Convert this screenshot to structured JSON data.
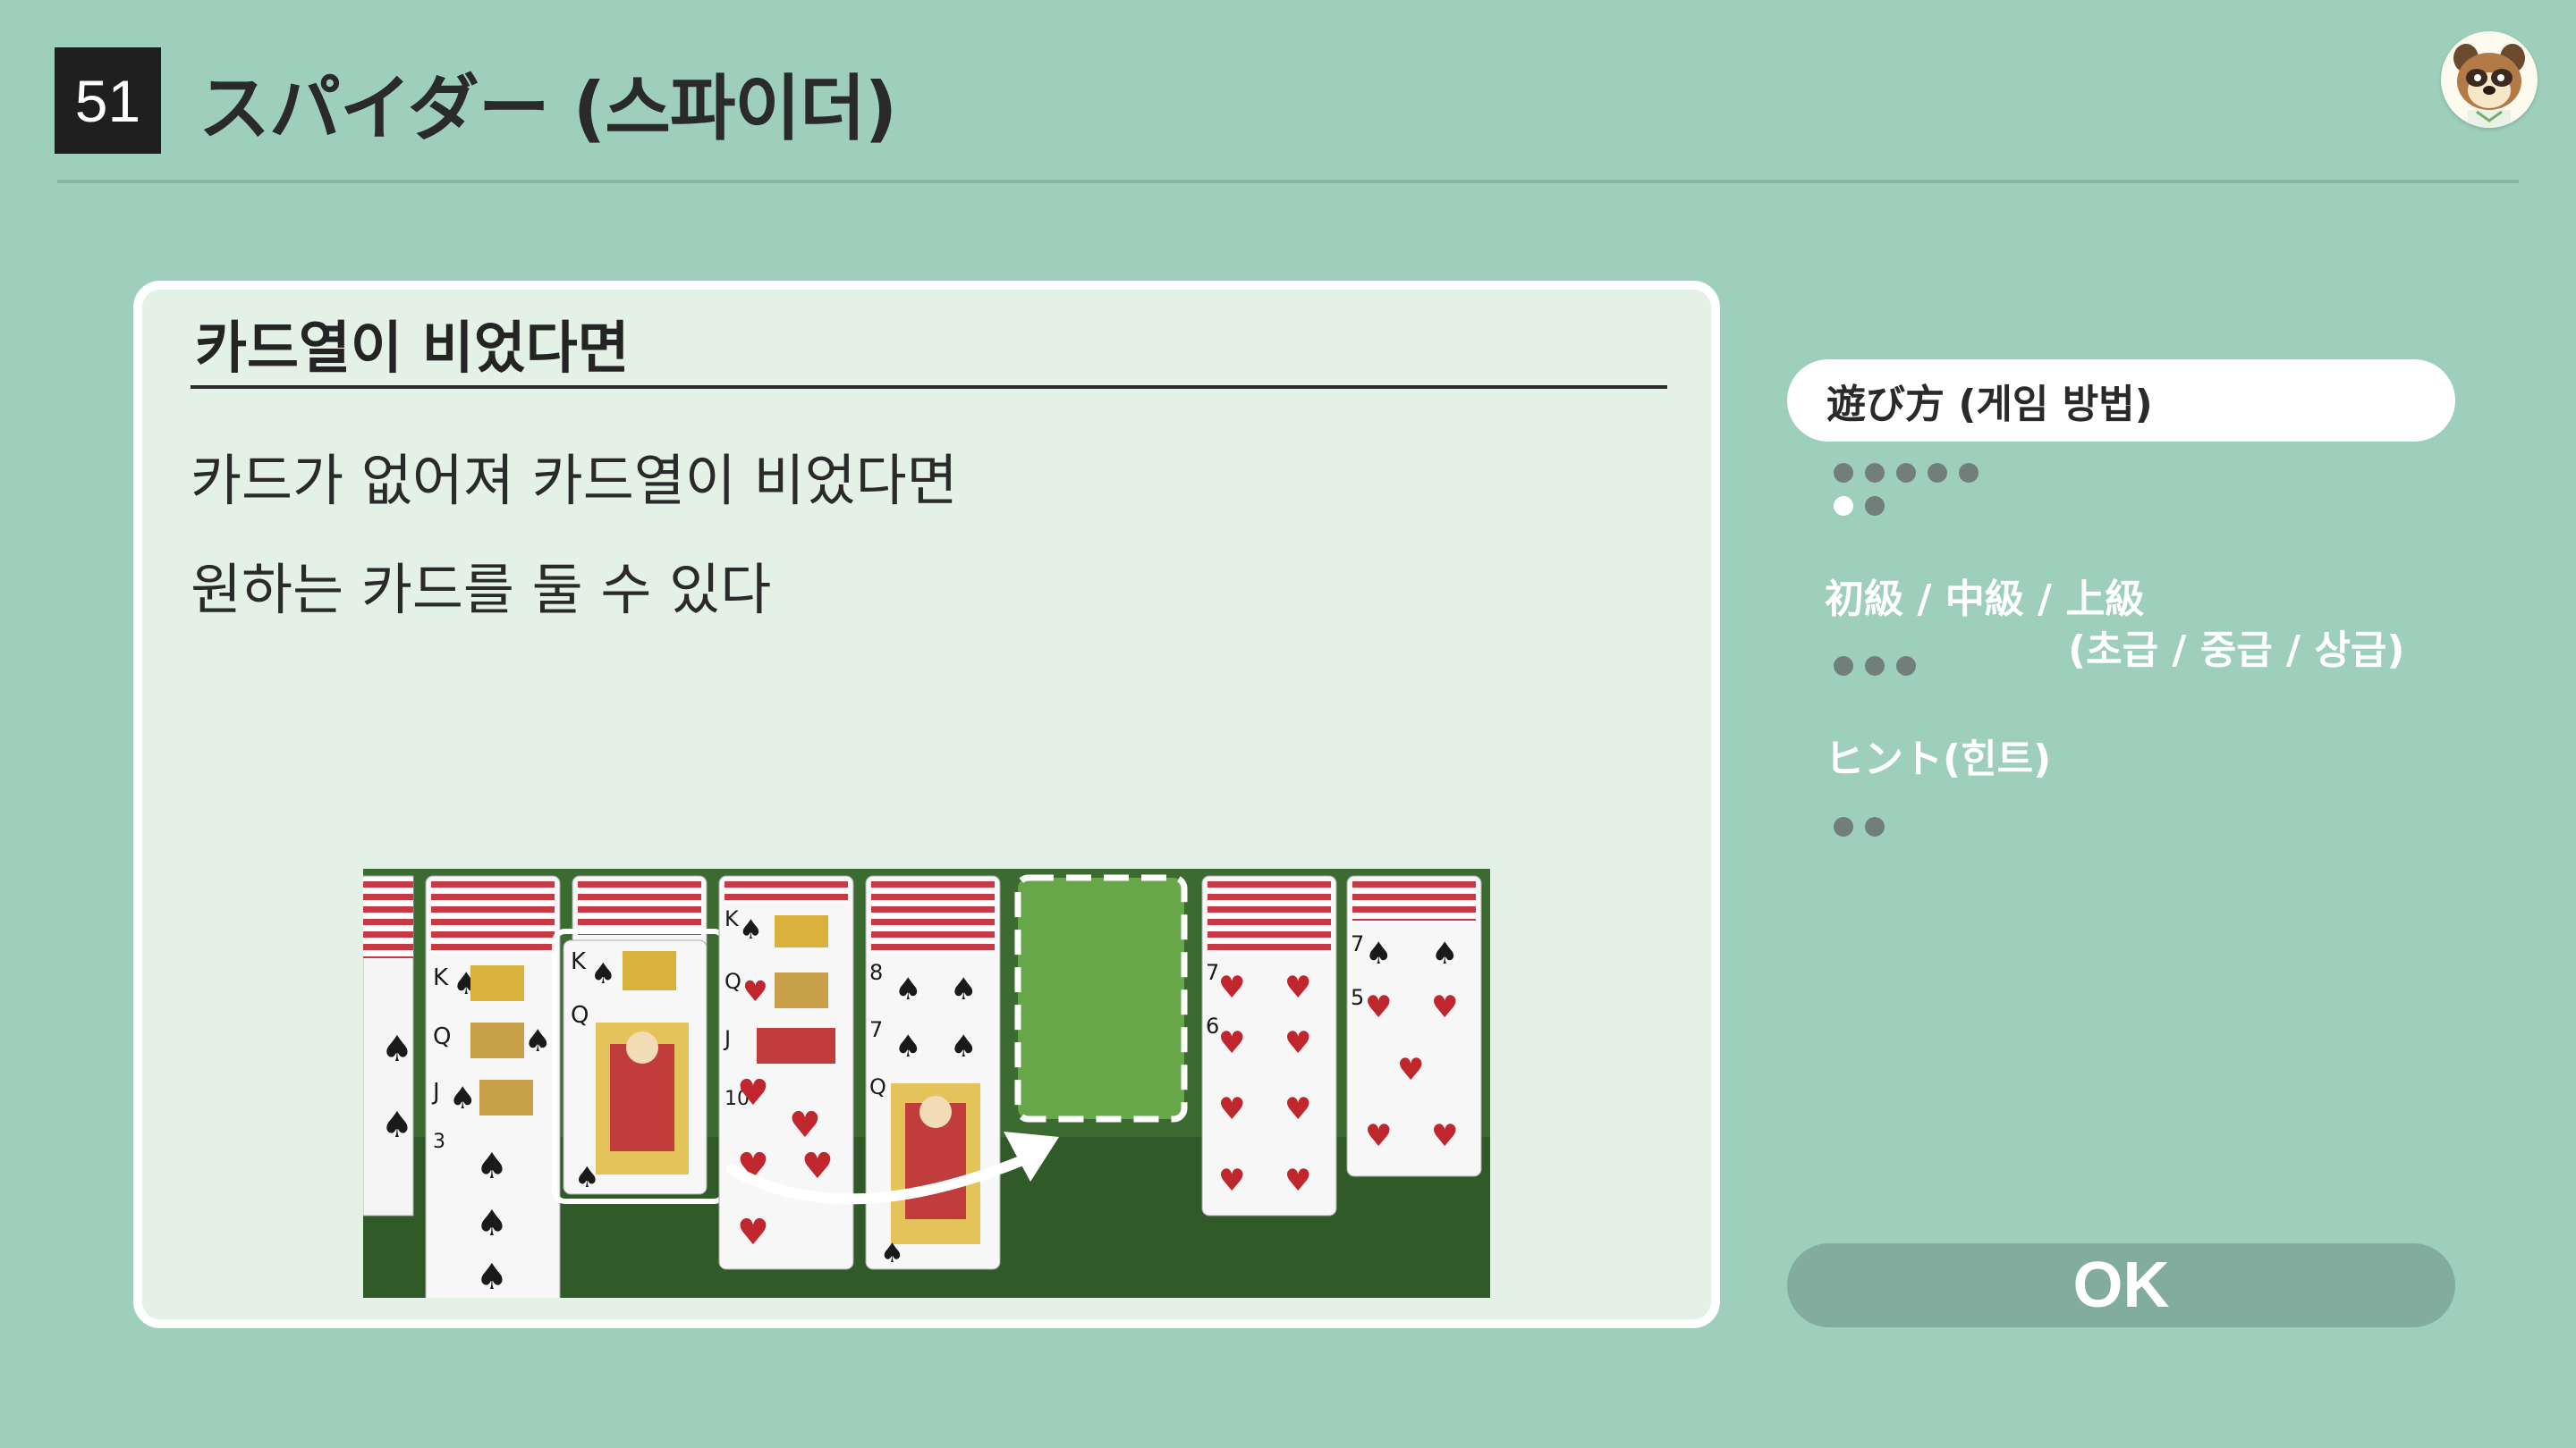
{
  "header": {
    "game_number": "51",
    "title": "スパイダー (스파이더)"
  },
  "content": {
    "heading": "카드열이 비었다면",
    "lines": [
      "카드가 없어져 카드열이 비었다면",
      "원하는 카드를 둘 수 있다"
    ]
  },
  "sidebar": {
    "tabs": [
      {
        "label": "遊び方 (게임 방법)",
        "active": true,
        "pages": 7,
        "current_page": 6
      },
      {
        "label": "初級 / 中級 / 上級",
        "sub_label": "(초급 / 중급 / 상급)",
        "active": false,
        "pages": 3
      },
      {
        "label": "ヒント(힌트)",
        "active": false,
        "pages": 2
      }
    ],
    "ok_label": "OK"
  },
  "colors": {
    "background": "#9dcfbc",
    "panel": "#e3f1e7",
    "felt": "#3c6b32",
    "dot": "#717e79",
    "ok_button": "#81ac9e"
  },
  "icons": [
    "raccoon-avatar-icon",
    "arrow-icon",
    "empty-slot-icon"
  ],
  "illustration": {
    "tableau": [
      {
        "cards": []
      },
      {
        "cards": [
          {
            "rank": "K",
            "suit": "♠"
          },
          {
            "rank": "Q",
            "suit": "♠"
          },
          {
            "rank": "J",
            "suit": "♠"
          },
          {
            "rank": "3",
            "suit": "♠"
          }
        ]
      },
      {
        "cards": [
          {
            "rank": "K",
            "suit": "♠"
          },
          {
            "rank": "Q",
            "suit": "♠"
          }
        ]
      },
      {
        "cards": [
          {
            "rank": "K",
            "suit": "♠"
          },
          {
            "rank": "Q",
            "suit": "♥"
          },
          {
            "rank": "J",
            "suit": "♥"
          },
          {
            "rank": "10",
            "suit": "♥"
          }
        ]
      },
      {
        "cards": [
          {
            "rank": "8",
            "suit": "♠"
          },
          {
            "rank": "7",
            "suit": "♠"
          },
          {
            "rank": "Q",
            "suit": "♠"
          }
        ]
      },
      {
        "cards": []
      },
      {
        "cards": [
          {
            "rank": "7",
            "suit": "♥"
          },
          {
            "rank": "6",
            "suit": "♥"
          }
        ]
      },
      {
        "cards": [
          {
            "rank": "7",
            "suit": "♠"
          },
          {
            "rank": "5",
            "suit": "♥"
          }
        ]
      }
    ]
  }
}
